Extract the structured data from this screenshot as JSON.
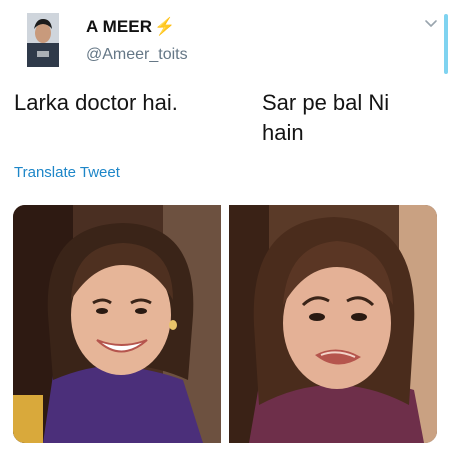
{
  "tweet": {
    "display_name": "A MEER",
    "name_emoji": "⚡",
    "handle": "@Ameer_toits",
    "text_left": "Larka doctor hai.",
    "text_right": "Sar pe bal Ni hain",
    "translate_link": "Translate Tweet"
  },
  "media": [
    {
      "description_icon": "meme-face-happy"
    },
    {
      "description_icon": "meme-face-crying"
    }
  ],
  "colors": {
    "link": "#1d86c8",
    "handle": "#657786",
    "bolt": "#f5a623",
    "scrollbar": "#7fd3f0"
  }
}
